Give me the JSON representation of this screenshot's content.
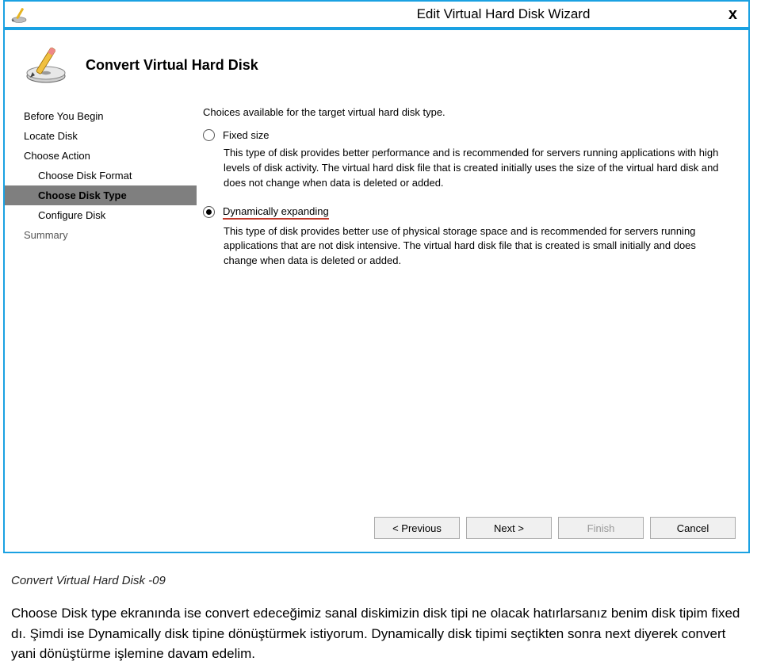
{
  "window": {
    "title": "Edit Virtual Hard Disk Wizard",
    "close_label": "x"
  },
  "header": {
    "title": "Convert Virtual Hard Disk"
  },
  "sidebar": {
    "items": [
      {
        "label": "Before You Begin",
        "indent": false,
        "selected": false,
        "dim": false
      },
      {
        "label": "Locate Disk",
        "indent": false,
        "selected": false,
        "dim": false
      },
      {
        "label": "Choose Action",
        "indent": false,
        "selected": false,
        "dim": false
      },
      {
        "label": "Choose Disk Format",
        "indent": true,
        "selected": false,
        "dim": false
      },
      {
        "label": "Choose Disk Type",
        "indent": true,
        "selected": true,
        "dim": false
      },
      {
        "label": "Configure Disk",
        "indent": true,
        "selected": false,
        "dim": false
      },
      {
        "label": "Summary",
        "indent": false,
        "selected": false,
        "dim": true
      }
    ]
  },
  "main": {
    "intro": "Choices available for the target virtual hard disk type.",
    "options": [
      {
        "label": "Fixed size",
        "checked": false,
        "underline": false,
        "desc": "This type of disk provides better performance and is recommended for servers running applications with high levels of disk activity. The virtual hard disk file that is created initially uses the size of the virtual hard disk and does not change when data is deleted or added."
      },
      {
        "label": "Dynamically expanding",
        "checked": true,
        "underline": true,
        "desc": "This type of disk provides better use of physical storage space and is recommended for servers running applications that are not disk intensive. The virtual hard disk file that is created is small initially and does change when data is deleted or added."
      }
    ]
  },
  "buttons": {
    "previous": "< Previous",
    "next": "Next >",
    "finish": "Finish",
    "cancel": "Cancel"
  },
  "article": {
    "caption": "Convert Virtual Hard Disk -09",
    "body": "Choose Disk type ekranında ise convert edeceğimiz sanal diskimizin disk tipi ne olacak hatırlarsanız benim disk tipim fixed dı. Şimdi ise Dynamically disk tipine dönüştürmek istiyorum. Dynamically disk tipimi seçtikten sonra next diyerek convert yani dönüştürme işlemine davam edelim."
  }
}
